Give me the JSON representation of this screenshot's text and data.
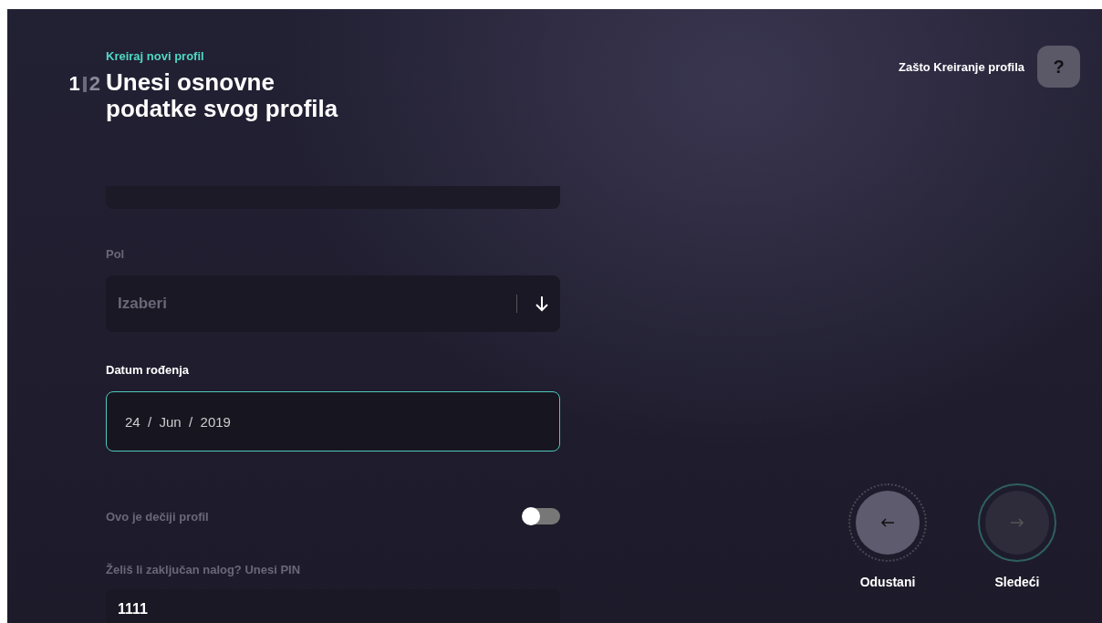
{
  "header": {
    "eyebrow": "Kreiraj novi profil",
    "steps": [
      {
        "label": "1",
        "selected": true
      },
      {
        "label": "2",
        "selected": false
      }
    ],
    "title": "Unesi osnovne podatke svog profila"
  },
  "help": {
    "label": "Zašto Kreiranje profila",
    "button": "?"
  },
  "form": {
    "gender": {
      "label": "Pol",
      "placeholder": "Izaberi",
      "focused": false
    },
    "birth_date": {
      "label": "Datum rođenja",
      "value": "24  /  Jun  /  2019",
      "focused": true
    },
    "kids_profile": {
      "label": "Ovo je dečiji profil",
      "on": false
    },
    "pin": {
      "label": "Želiš li zaključan nalog? Unesi PIN",
      "value": "1111"
    }
  },
  "nav": [
    {
      "kind": "back",
      "label": "Odustani",
      "disabled": false
    },
    {
      "kind": "next",
      "label": "Sledeći",
      "disabled": true
    }
  ]
}
